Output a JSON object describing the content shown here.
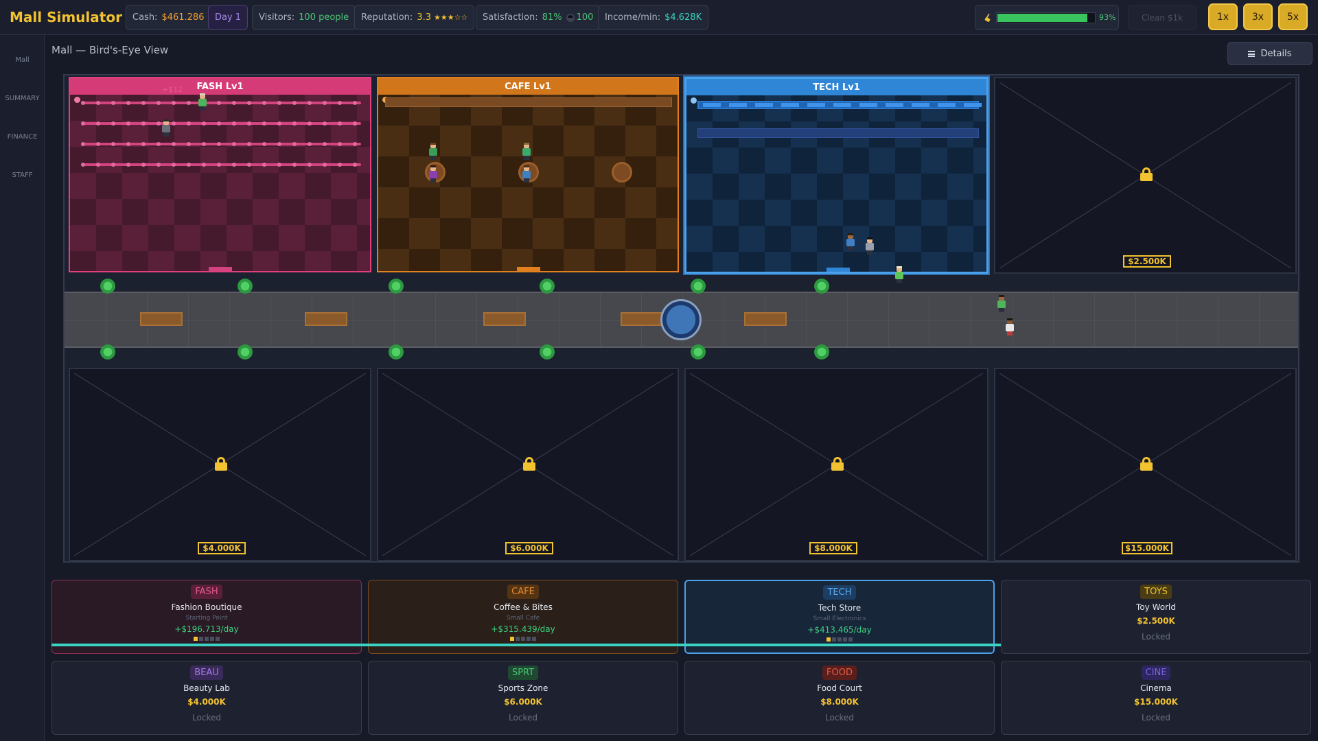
{
  "app": {
    "title": "Mall Simulator"
  },
  "stats": {
    "cash_label": "Cash:",
    "cash_value": "$461.286",
    "day": "Day 1",
    "visitors_label": "Visitors:",
    "visitors_value": "100 people",
    "reputation_label": "Reputation:",
    "reputation_value": "3.3",
    "reputation_stars": "★★★☆☆",
    "satisfaction_label": "Satisfaction:",
    "satisfaction_value": "81%",
    "satisfaction_count": "100",
    "income_label": "Income/min:",
    "income_value": "$4.628K"
  },
  "cleanliness": {
    "percent": 93,
    "percent_label": "93%",
    "button_label": "Clean  $1k",
    "icon": "broom-icon"
  },
  "speed": {
    "options": [
      "1x",
      "3x",
      "5x"
    ]
  },
  "sidebar": {
    "items": [
      "Mall",
      "SUMMARY",
      "FINANCE",
      "STAFF"
    ]
  },
  "view": {
    "title": "Mall — Bird's-Eye View",
    "details_label": "Details",
    "details_icon": "menu-icon"
  },
  "mall": {
    "stores": [
      {
        "id": "fash",
        "label": "FASH Lv1",
        "float_text": "+$12"
      },
      {
        "id": "cafe",
        "label": "CAFE Lv1"
      },
      {
        "id": "tech",
        "label": "TECH Lv1"
      }
    ],
    "locked_prices": [
      "$2.500K",
      "$4.000K",
      "$6.000K",
      "$8.000K",
      "$15.000K"
    ]
  },
  "cards": [
    {
      "code": "FASH",
      "name": "Fashion Boutique",
      "sub": "Starting Point",
      "income": "+$196.713/day",
      "level": 1,
      "color": "#e0417e"
    },
    {
      "code": "CAFE",
      "name": "Coffee & Bites",
      "sub": "Small Cafe",
      "income": "+$315.439/day",
      "level": 1,
      "color": "#e2801f"
    },
    {
      "code": "TECH",
      "name": "Tech Store",
      "sub": "Small Electronics",
      "income": "+$413.465/day",
      "level": 1,
      "color": "#4ba1ec"
    },
    {
      "code": "TOYS",
      "name": "Toy World",
      "cost": "$2.500K",
      "state": "Locked",
      "color": "#d9aa25"
    },
    {
      "code": "BEAU",
      "name": "Beauty Lab",
      "cost": "$4.000K",
      "state": "Locked",
      "color": "#8a5ad6"
    },
    {
      "code": "SPRT",
      "name": "Sports Zone",
      "cost": "$6.000K",
      "state": "Locked",
      "color": "#3fae6a"
    },
    {
      "code": "FOOD",
      "name": "Food Court",
      "cost": "$8.000K",
      "state": "Locked",
      "color": "#d24a3a"
    },
    {
      "code": "CINE",
      "name": "Cinema",
      "cost": "$15.000K",
      "state": "Locked",
      "color": "#6a55c9"
    }
  ]
}
